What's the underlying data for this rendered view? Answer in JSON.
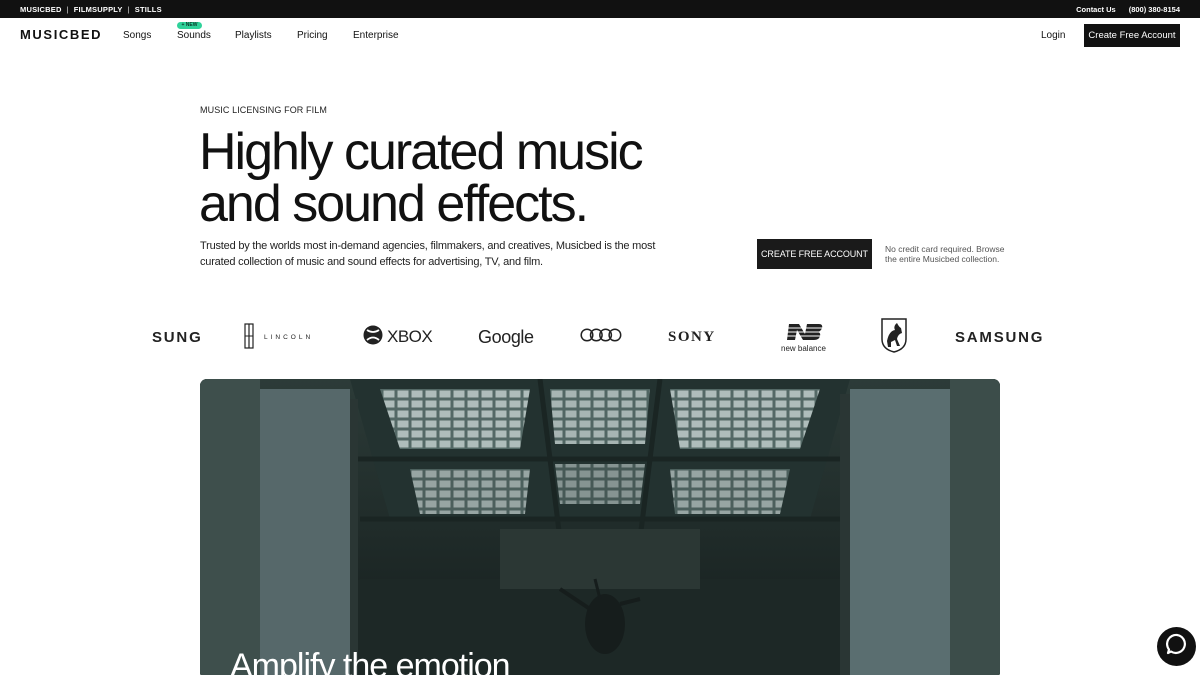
{
  "topbar": {
    "brands": [
      "MUSICBED",
      "FILMSUPPLY",
      "STILLS"
    ],
    "separator": "|",
    "contact": "Contact Us",
    "phone": "(800) 380-8154"
  },
  "nav": {
    "logo": "MUSICBED",
    "items": [
      "Songs",
      "Sounds",
      "Playlists",
      "Pricing",
      "Enterprise"
    ],
    "new_badge": "+ NEW",
    "login": "Login",
    "cta": "Create Free Account"
  },
  "hero": {
    "eyebrow": "MUSIC LICENSING FOR FILM",
    "headline_line1": "Highly curated music",
    "headline_line2": "and sound effects.",
    "lead": "Trusted by the worlds most in-demand agencies, filmmakers, and creatives, Musicbed is the most curated collection of music and sound effects for advertising, TV, and film.",
    "cta": "CREATE FREE ACCOUNT",
    "cta_note": "No credit card required. Browse the entire Musicbed collection."
  },
  "logos": {
    "samsung_left": "SUNG",
    "lincoln": "LINCOLN",
    "xbox": "XBOX",
    "google": "Google",
    "sony": "SONY",
    "new_balance": "new balance",
    "samsung_right": "SAMSUNG",
    "icons": [
      "lincoln-star-icon",
      "xbox-sphere-icon",
      "audi-rings-icon",
      "new-balance-nb-icon",
      "lamborghini-bull-icon"
    ]
  },
  "video": {
    "caption": "Amplify the emotion"
  },
  "chat": {
    "icon": "chat-bubble-icon"
  },
  "colors": {
    "topbar_bg": "#111111",
    "new_badge": "#2fd29a",
    "cta_bg": "#111111"
  }
}
